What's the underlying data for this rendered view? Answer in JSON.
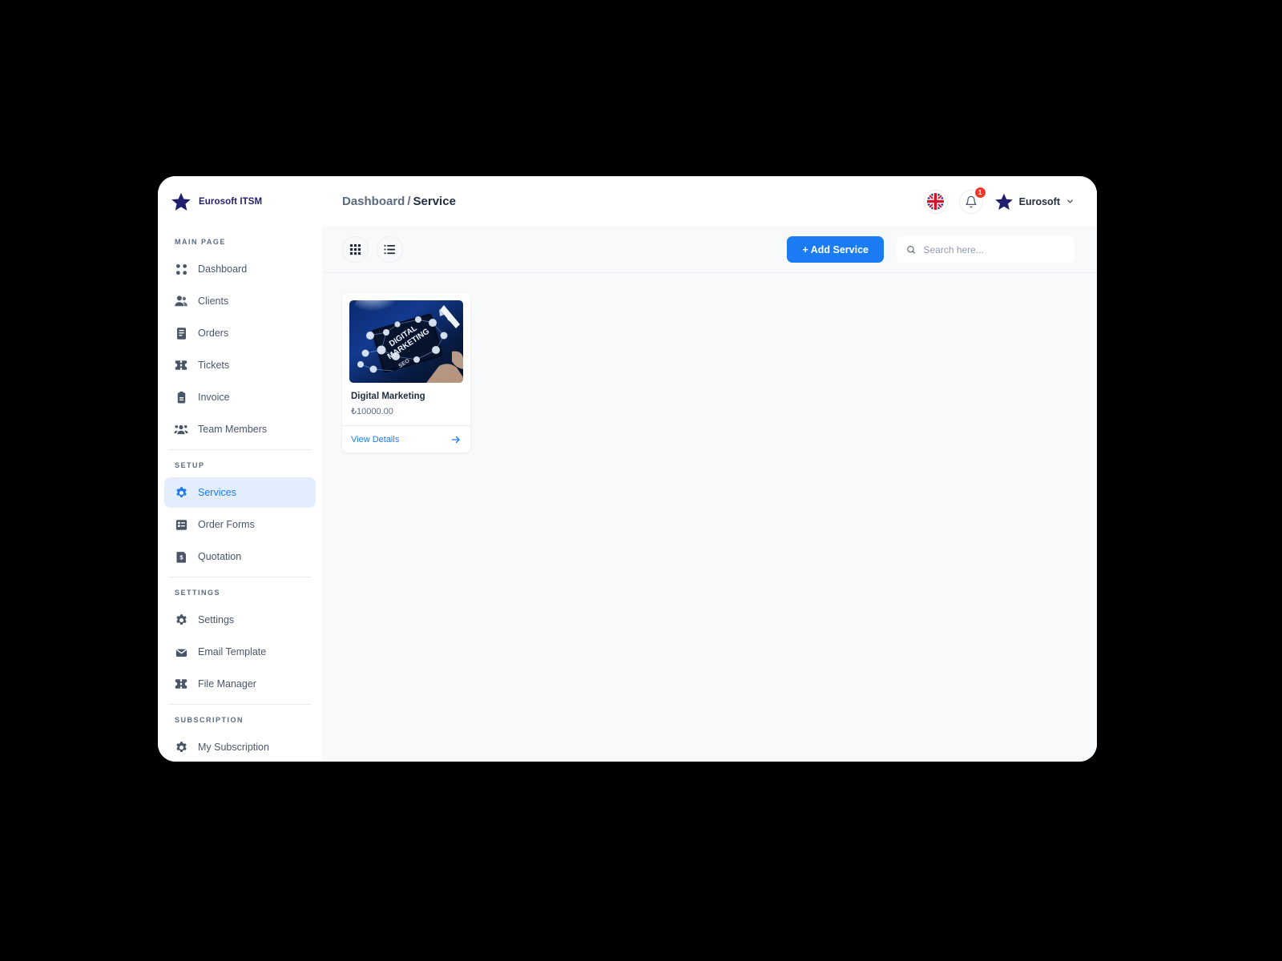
{
  "brand": {
    "name": "Eurosoft ITSM",
    "logo_icon": "star-icon",
    "color": "#221e6e"
  },
  "theme": {
    "accent": "#1a7bf2",
    "active_bg": "#e2edfd",
    "badge": "#f1392b",
    "page_bg": "#f8f9fb"
  },
  "sidebar": {
    "sections": [
      {
        "heading": "MAIN PAGE",
        "items": [
          {
            "label": "Dashboard",
            "icon": "grid-dots-icon",
            "active": false
          },
          {
            "label": "Clients",
            "icon": "people-icon",
            "active": false
          },
          {
            "label": "Orders",
            "icon": "document-icon",
            "active": false
          },
          {
            "label": "Tickets",
            "icon": "ticket-icon",
            "active": false
          },
          {
            "label": "Invoice",
            "icon": "clipboard-icon",
            "active": false
          },
          {
            "label": "Team Members",
            "icon": "group-icon",
            "active": false
          }
        ]
      },
      {
        "heading": "SETUP",
        "items": [
          {
            "label": "Services",
            "icon": "gear-icon",
            "active": true
          },
          {
            "label": "Order Forms",
            "icon": "form-icon",
            "active": false
          },
          {
            "label": "Quotation",
            "icon": "quotation-icon",
            "active": false
          }
        ]
      },
      {
        "heading": "SETTINGS",
        "items": [
          {
            "label": "Settings",
            "icon": "gear-icon",
            "active": false
          },
          {
            "label": "Email Template",
            "icon": "envelope-icon",
            "active": false
          },
          {
            "label": "File Manager",
            "icon": "ticket-icon",
            "active": false
          }
        ]
      },
      {
        "heading": "SUBSCRIPTION",
        "items": [
          {
            "label": "My Subscription",
            "icon": "gear-icon",
            "active": false
          }
        ]
      }
    ]
  },
  "topbar": {
    "breadcrumb": {
      "parent": "Dashboard",
      "separator": "/",
      "current": "Service"
    },
    "language_icon": "uk-flag-icon",
    "notifications": {
      "icon": "bell-icon",
      "count": "1"
    },
    "user": {
      "avatar_icon": "star-icon",
      "name": "Eurosoft",
      "chevron": "chevron-down-icon"
    }
  },
  "toolbar": {
    "grid_view_icon": "grid-view-icon",
    "list_view_icon": "list-view-icon",
    "add_label": "+ Add Service",
    "search": {
      "placeholder": "Search here...",
      "value": "",
      "icon": "search-icon"
    }
  },
  "services": [
    {
      "title": "Digital Marketing",
      "price": "₺10000.00",
      "link_label": "View Details",
      "arrow_icon": "arrow-right-icon",
      "thumb_alt": "digital-marketing-tablet-photo"
    }
  ]
}
